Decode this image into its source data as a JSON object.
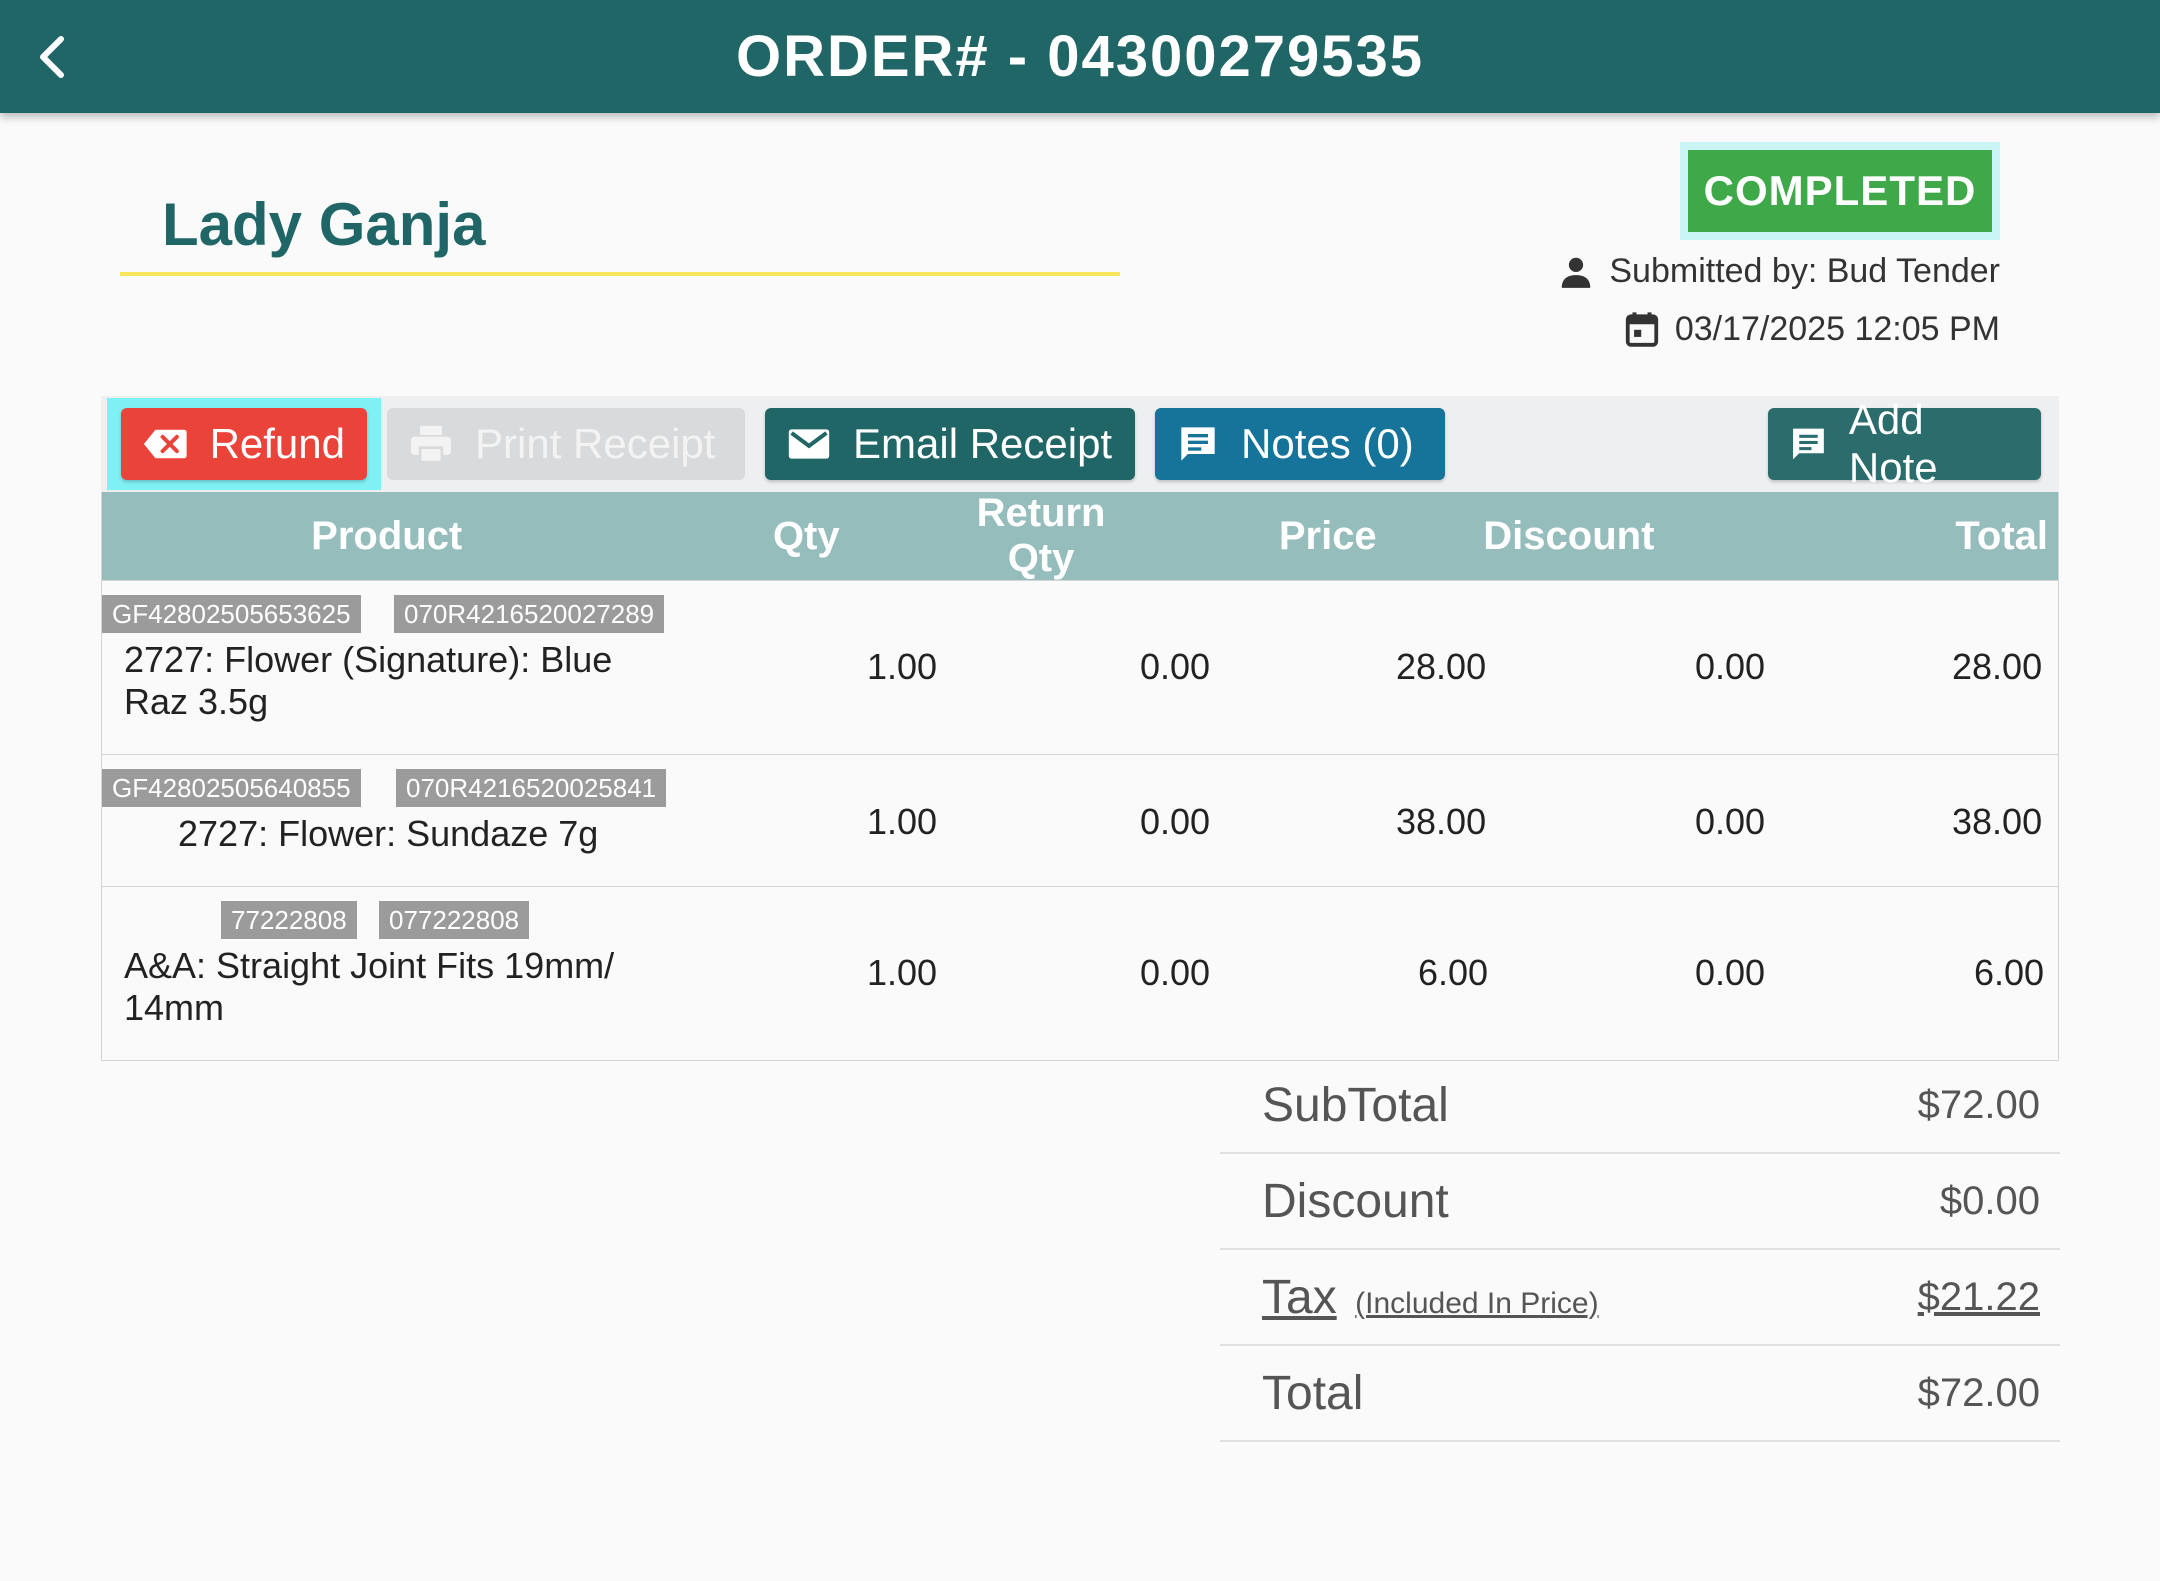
{
  "header": {
    "title": "ORDER# - 04300279535"
  },
  "customer": {
    "name": "Lady Ganja"
  },
  "status": {
    "label": "COMPLETED",
    "color": "#3fa94a"
  },
  "meta": {
    "submitted_by": "Submitted by: Bud Tender",
    "datetime": "03/17/2025 12:05 PM"
  },
  "toolbar": {
    "refund": "Refund",
    "print_receipt": "Print Receipt",
    "email_receipt": "Email Receipt",
    "notes": "Notes (0)",
    "add_note": "Add Note"
  },
  "table": {
    "headers": [
      "Product",
      "Qty",
      "Return Qty",
      "Price",
      "Discount",
      "Total"
    ],
    "rows": [
      {
        "sku1": "GF42802505653625",
        "sku2": "070R4216520027289",
        "name": "2727: Flower (Signature): Blue Raz 3.5g",
        "qty": "1.00",
        "return_qty": "0.00",
        "price": "28.00",
        "discount": "0.00",
        "total": "28.00"
      },
      {
        "sku1": "GF42802505640855",
        "sku2": "070R4216520025841",
        "name": "2727: Flower: Sundaze 7g",
        "qty": "1.00",
        "return_qty": "0.00",
        "price": "38.00",
        "discount": "0.00",
        "total": "38.00"
      },
      {
        "sku1": "77222808",
        "sku2": "077222808",
        "name": "A&A: Straight Joint Fits 19mm/ 14mm",
        "qty": "1.00",
        "return_qty": "0.00",
        "price": "6.00",
        "discount": "0.00",
        "total": "6.00"
      }
    ]
  },
  "totals": {
    "subtotal_label": "SubTotal",
    "subtotal": "$72.00",
    "discount_label": "Discount",
    "discount": "$0.00",
    "tax_label": "Tax",
    "tax_note": "(Included In Price)",
    "tax": "$21.22",
    "total_label": "Total",
    "total": "$72.00"
  },
  "icons": {
    "back": "chevron-left-icon",
    "user": "person-icon",
    "calendar": "calendar-icon",
    "refund": "backspace-x-icon",
    "print": "printer-icon",
    "email": "envelope-icon",
    "notes": "comment-icon",
    "add_note": "comment-icon"
  }
}
